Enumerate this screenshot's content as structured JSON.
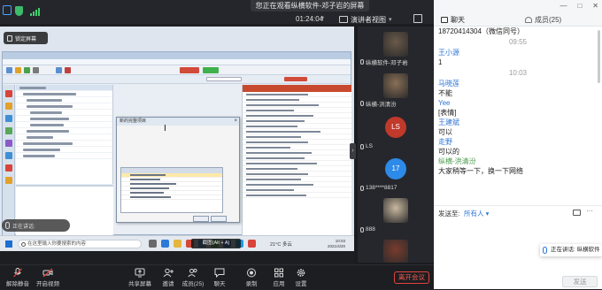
{
  "topbar": {
    "watching_label": "您正在观看纵横软件-邓子岩的屏幕",
    "timer": "01:24:04",
    "view_label": "演讲者视图"
  },
  "share": {
    "lock_screen_label": "锁定屏幕",
    "dialog_title": "新的完整项目",
    "speaking_label": "正在讲话:",
    "screenshot_tip": "截图(Alt + A)",
    "taskbar": {
      "search_placeholder": "在这里输入你要搜索的内容",
      "weather": "21°C 多云",
      "clock_time": "10:03",
      "clock_date": "2021/4/20"
    }
  },
  "video_strip": [
    {
      "name": "纵横软件-邓子岩",
      "kind": "photo",
      "color": "#6b5a4a"
    },
    {
      "name": "纵横-洪清汾",
      "kind": "photo",
      "color": "#8a6f56"
    },
    {
      "name": "LS",
      "kind": "avatar",
      "initials": "LS",
      "color": "#c0392b"
    },
    {
      "name": "138****8817",
      "kind": "avatar",
      "initials": "17",
      "color": "#2d8ae8"
    },
    {
      "name": "888",
      "kind": "photo",
      "color": "#c9b8a0"
    },
    {
      "name": "",
      "kind": "photo",
      "color": "#7a3b2e"
    }
  ],
  "bottombar": {
    "mute": "解除静音",
    "video": "开启视频",
    "share": "共享屏幕",
    "invite": "邀请",
    "members": "成员(25)",
    "chat": "聊天",
    "record": "录制",
    "apps": "应用",
    "settings": "设置",
    "leave": "离开会议"
  },
  "chat": {
    "tab_chat": "聊天",
    "tab_members": "成员(25)",
    "messages": [
      {
        "type": "text",
        "text": "18720414304（微信同号）"
      },
      {
        "type": "time",
        "text": "09:55"
      },
      {
        "type": "sender",
        "text": "王小源",
        "color": "blue"
      },
      {
        "type": "text",
        "text": "1"
      },
      {
        "type": "time",
        "text": "10:03"
      },
      {
        "type": "sender",
        "text": "马晓莲",
        "color": "blue"
      },
      {
        "type": "text",
        "text": "不能"
      },
      {
        "type": "sender",
        "text": "Yee",
        "color": "blue"
      },
      {
        "type": "text",
        "text": "[表情]"
      },
      {
        "type": "sender",
        "text": "王建斌",
        "color": "blue"
      },
      {
        "type": "text",
        "text": "可以"
      },
      {
        "type": "sender",
        "text": "走野",
        "color": "blue"
      },
      {
        "type": "text",
        "text": "可以的"
      },
      {
        "type": "sender",
        "text": "纵横-洪清汾",
        "color": "green"
      },
      {
        "type": "text",
        "text": "大家稍等一下，换一下网络"
      }
    ],
    "send_to_label": "发送至:",
    "send_target": "所有人",
    "input_placeholder": "",
    "speaking_toast": "正在讲话: 纵横软件",
    "send_label": "发送"
  }
}
